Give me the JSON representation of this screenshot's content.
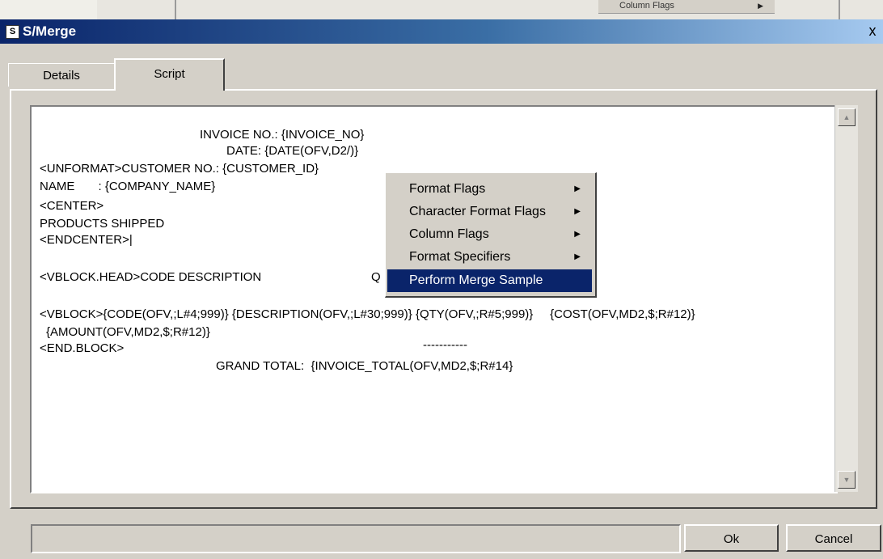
{
  "background_window": {
    "menu_item_label": "Column Flags"
  },
  "window": {
    "title": "S/Merge",
    "close_label": "x"
  },
  "tabs": [
    {
      "label": "Details"
    },
    {
      "label": "Script"
    }
  ],
  "editor": {
    "lines": [
      "INVOICE NO.: {INVOICE_NO}",
      "DATE: {DATE(OFV,D2/)}",
      "<UNFORMAT>CUSTOMER NO.: {CUSTOMER_ID}",
      "NAME       : {COMPANY_NAME}",
      "<CENTER>",
      "PRODUCTS SHIPPED",
      "<ENDCENTER>|",
      "<VBLOCK.HEAD>CODE DESCRIPTION",
      "Q",
      "<VBLOCK>{CODE(OFV,;L#4;999)} {DESCRIPTION(OFV,;L#30;999)} {QTY(OFV,;R#5;999)}     {COST(OFV,MD2,$;R#12)}",
      "{AMOUNT(OFV,MD2,$;R#12)}",
      "<END.BLOCK>",
      "-----------",
      "GRAND TOTAL:  {INVOICE_TOTAL(OFV,MD2,$;R#14}"
    ]
  },
  "context_menu": {
    "items": [
      {
        "label": "Format Flags",
        "submenu": true
      },
      {
        "label": "Character Format Flags",
        "submenu": true
      },
      {
        "label": "Column Flags",
        "submenu": true
      },
      {
        "label": "Format Specifiers",
        "submenu": true
      },
      {
        "label": "Perform Merge Sample",
        "submenu": false,
        "selected": true
      }
    ]
  },
  "buttons": {
    "ok_label": "Ok",
    "cancel_label": "Cancel"
  },
  "colors": {
    "title_bar": "#0a246a",
    "selection": "#0a246a",
    "face": "#d4d0c8"
  }
}
